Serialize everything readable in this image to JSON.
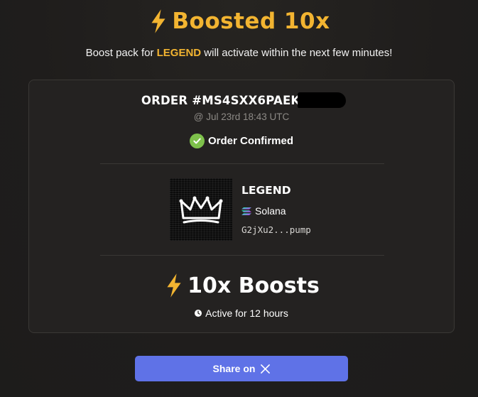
{
  "header": {
    "title": "Boosted 10x",
    "subtitle_before": "Boost pack for ",
    "subtitle_highlight": "LEGEND",
    "subtitle_after": " will activate within the next few minutes!"
  },
  "order": {
    "id": "ORDER #MS4SXX6PAEK7VILVI",
    "date": "@ Jul 23rd 18:43 UTC",
    "status": "Order Confirmed"
  },
  "token": {
    "name": "LEGEND",
    "chain": "Solana",
    "address": "G2jXu2...pump"
  },
  "boost": {
    "label": "10x Boosts",
    "duration": "Active for 12 hours"
  },
  "share": {
    "label": "Share on",
    "icon": "x-logo-icon"
  },
  "colors": {
    "accent": "#f2b431",
    "success": "#7ec14b",
    "button": "#5f72e7",
    "background": "#1f1d1c",
    "card": "#242221"
  },
  "icons": {
    "bolt": "lightning-bolt-icon",
    "check": "check-circle-icon",
    "chain": "solana-icon",
    "clock": "clock-icon",
    "token_image": "crown-icon"
  }
}
